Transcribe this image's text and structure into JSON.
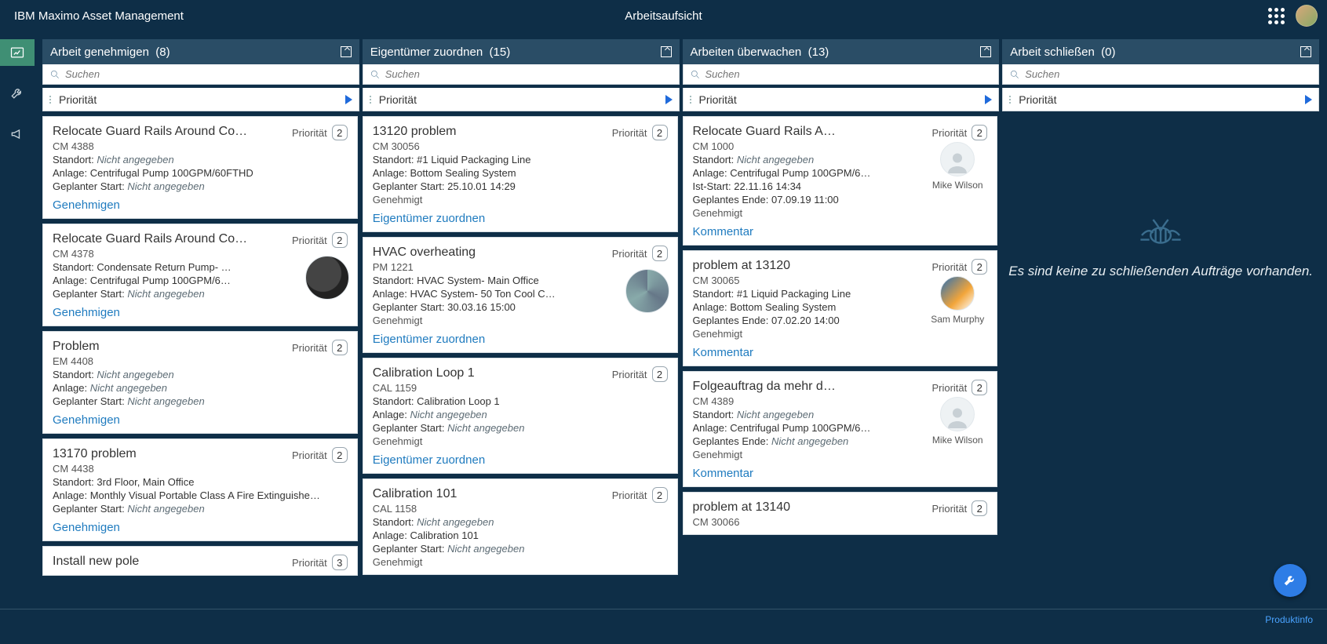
{
  "header": {
    "productTitle": "IBM Maximo Asset Management",
    "pageTitle": "Arbeitsaufsicht"
  },
  "labels": {
    "priority": "Priorität",
    "searchPlaceholder": "Suchen",
    "location": "Standort:",
    "asset": "Anlage:",
    "plannedStart": "Geplanter Start:",
    "actualStart": "Ist-Start:",
    "plannedEnd": "Geplantes Ende:",
    "notGiven": "Nicht angegeben",
    "approved": "Genehmigt",
    "approve": "Genehmigen",
    "assignOwner": "Eigentümer zuordnen",
    "comment": "Kommentar",
    "footerProductInfo": "Produktinfo"
  },
  "columns": [
    {
      "title": "Arbeit genehmigen",
      "count": "(8)",
      "filter": "Priorität",
      "type": "approve",
      "cards": [
        {
          "title": "Relocate Guard Rails Around Co…",
          "id": "CM 4388",
          "priority": "2",
          "location": null,
          "asset": "Centrifugal Pump 100GPM/60FTHD",
          "plannedStart": null
        },
        {
          "title": "Relocate Guard Rails Around Co…",
          "id": "CM 4378",
          "priority": "2",
          "location": "Condensate Return Pump- Ce…",
          "asset": "Centrifugal Pump 100GPM/60F…",
          "plannedStart": null,
          "thumb": "pump"
        },
        {
          "title": "Problem",
          "id": "EM 4408",
          "priority": "2",
          "location": null,
          "asset": null,
          "plannedStart": null
        },
        {
          "title": "13170 problem",
          "id": "CM 4438",
          "priority": "2",
          "location": "3rd Floor, Main Office",
          "asset": "Monthly Visual Portable Class A Fire Extinguishe…",
          "plannedStart": null
        },
        {
          "title": "Install new pole",
          "id": "",
          "priority": "3"
        }
      ]
    },
    {
      "title": "Eigentümer zuordnen",
      "count": "(15)",
      "filter": "Priorität",
      "type": "assign",
      "cards": [
        {
          "title": "13120 problem",
          "id": "CM 30056",
          "priority": "2",
          "location": "#1 Liquid Packaging Line",
          "asset": "Bottom Sealing System",
          "plannedStart": "25.10.01 14:29",
          "status": "Genehmigt"
        },
        {
          "title": "HVAC overheating",
          "id": "PM 1221",
          "priority": "2",
          "location": "HVAC System- Main Office",
          "asset": "HVAC System- 50 Ton Cool Cap/ …",
          "plannedStart": "30.03.16 15:00",
          "status": "Genehmigt",
          "thumb": "hvac"
        },
        {
          "title": "Calibration Loop 1",
          "id": "CAL 1159",
          "priority": "2",
          "location": "Calibration Loop 1",
          "asset": null,
          "plannedStart": null,
          "status": "Genehmigt"
        },
        {
          "title": "Calibration 101",
          "id": "CAL 1158",
          "priority": "2",
          "location": null,
          "asset": "Calibration 101",
          "plannedStart": null,
          "status": "Genehmigt"
        }
      ]
    },
    {
      "title": "Arbeiten überwachen",
      "count": "(13)",
      "filter": "Priorität",
      "type": "monitor",
      "cards": [
        {
          "title": "Relocate Guard Rails Around Co…",
          "id": "CM 1000",
          "priority": "2",
          "location": null,
          "asset": "Centrifugal Pump 100GPM/6…",
          "actualStart": "22.11.16 14:34",
          "plannedEnd": "07.09.19 11:00",
          "status": "Genehmigt",
          "owner": "Mike Wilson",
          "ownerPhoto": false
        },
        {
          "title": "problem at 13120",
          "id": "CM 30065",
          "priority": "2",
          "location": "#1 Liquid Packaging Line",
          "asset": "Bottom Sealing System",
          "plannedEnd": "07.02.20 14:00",
          "status": "Genehmigt",
          "owner": "Sam Murphy",
          "ownerPhoto": true
        },
        {
          "title": "Folgeauftrag da mehr defekt",
          "id": "CM 4389",
          "priority": "2",
          "location": null,
          "asset": "Centrifugal Pump 100GPM/6…",
          "plannedEnd": null,
          "status": "Genehmigt",
          "owner": "Mike Wilson",
          "ownerPhoto": false
        },
        {
          "title": "problem at 13140",
          "id": "CM 30066",
          "priority": "2"
        }
      ]
    },
    {
      "title": "Arbeit schließen",
      "count": "(0)",
      "filter": "Priorität",
      "type": "close",
      "emptyMessage": "Es sind keine zu schließenden Aufträge vorhanden."
    }
  ]
}
